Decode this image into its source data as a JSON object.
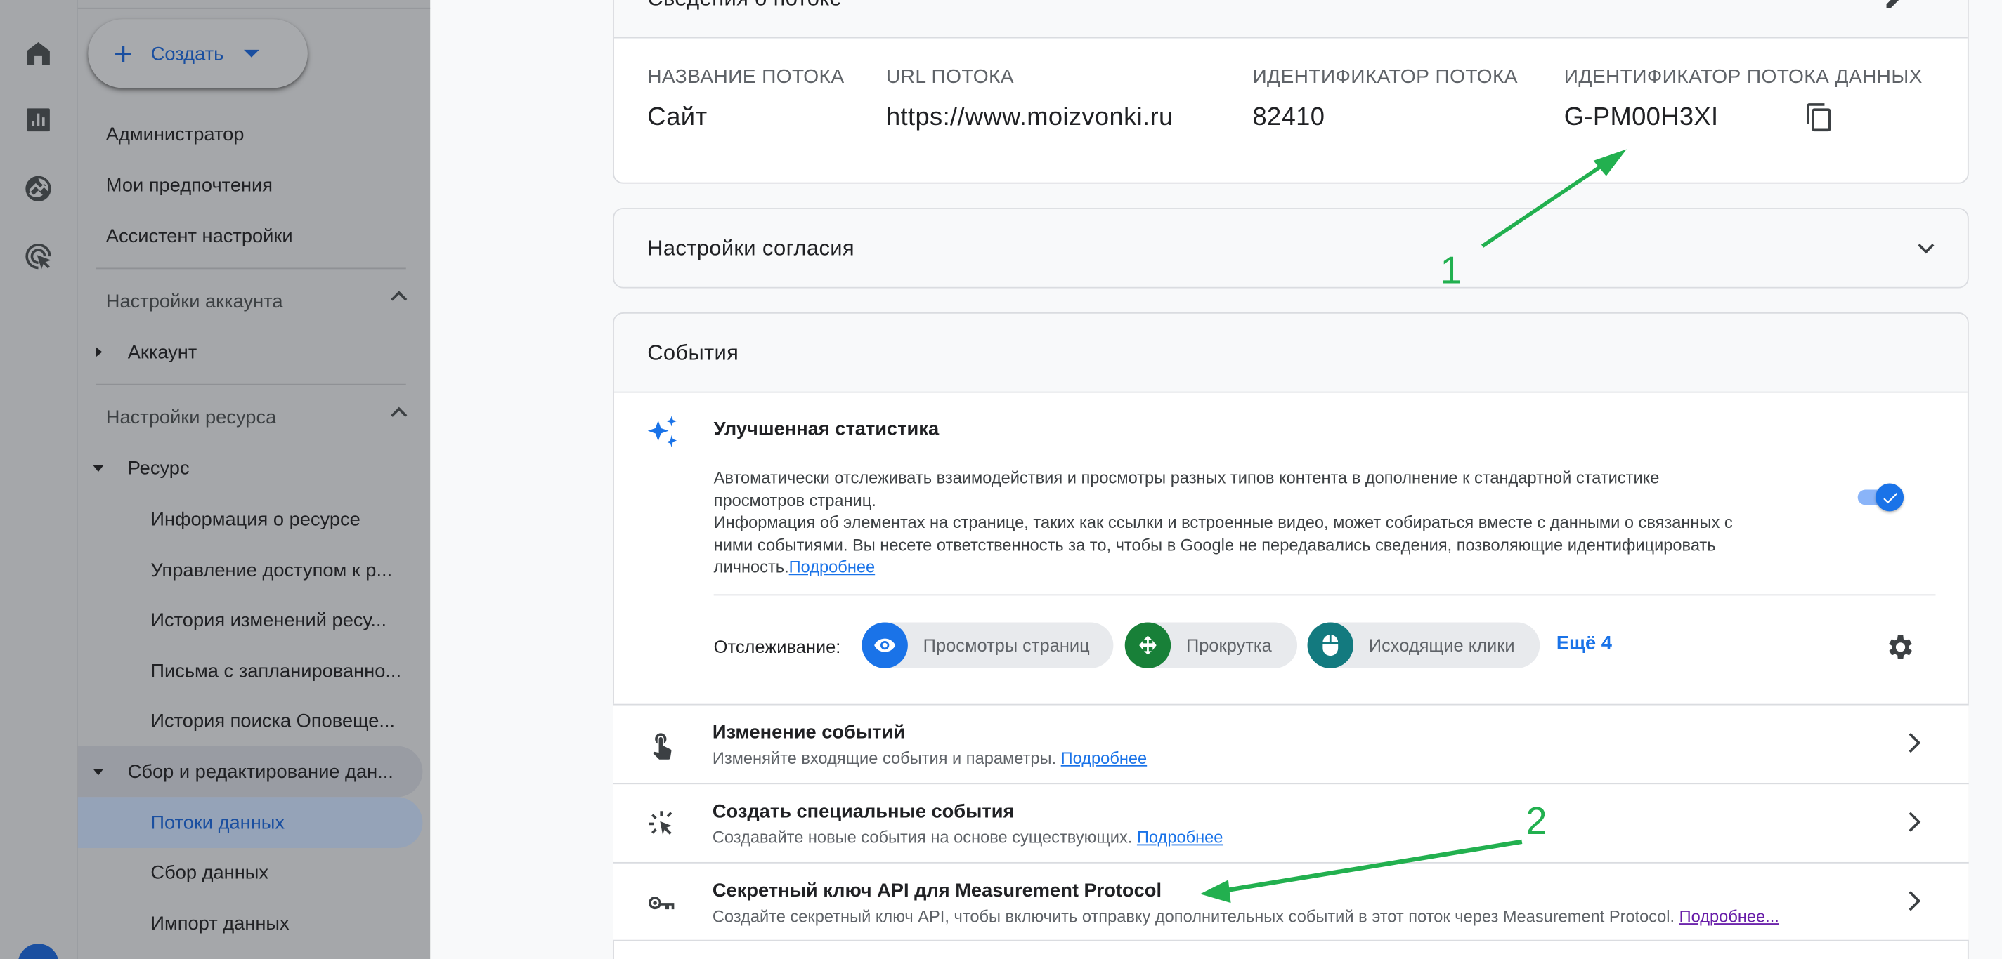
{
  "sidebar": {
    "create_label": "Создать",
    "items": {
      "admin": "Администратор",
      "prefs": "Мои предпочтения",
      "assistant": "Ассистент настройки",
      "account_settings": "Настройки аккаунта",
      "account": "Аккаунт",
      "resource_settings": "Настройки ресурса",
      "resource": "Ресурс",
      "resource_info": "Информация о ресурсе",
      "access_mgmt": "Управление доступом к р...",
      "change_history": "История изменений ресу...",
      "scheduled_emails": "Письма с запланированно...",
      "alerts_history": "История поиска Оповеще...",
      "data_collection": "Сбор и редактирование дан...",
      "data_streams": "Потоки данных",
      "data_gathering": "Сбор данных",
      "data_import": "Импорт данных"
    }
  },
  "stream_details": {
    "header": "Сведения о потоке",
    "name_label": "НАЗВАНИЕ ПОТОКА",
    "name_value": "Сайт",
    "url_label": "URL ПОТОКА",
    "url_value": "https://www.moizvonki.ru",
    "id_label": "ИДЕНТИФИКАТОР ПОТОКА",
    "id_value": "82410",
    "measurement_label": "ИДЕНТИФИКАТОР ПОТОКА ДАННЫХ",
    "measurement_value": "G-PM00H3XI"
  },
  "consent": {
    "title": "Настройки согласия"
  },
  "events": {
    "title": "События",
    "enhanced": {
      "title": "Улучшенная статистика",
      "desc_line1": "Автоматически отслеживать взаимодействия и просмотры разных типов контента в дополнение к стандартной статистике",
      "desc_line2": "просмотров страниц.",
      "desc_line3": "Информация об элементах на странице, таких как ссылки и встроенные видео, может собираться вместе с данными о связанных с",
      "desc_line4": "ними событиями. Вы несете ответственность за то, чтобы в Google не передавались сведения, позволяющие идентифицировать",
      "desc_line5": "личность.",
      "more_link": "Подробнее",
      "toggle_on": true,
      "tracking_label": "Отслеживание:",
      "chips": [
        "Просмотры страниц",
        "Прокрутка",
        "Исходящие клики"
      ],
      "more_chips": "Ещё 4"
    },
    "rows": [
      {
        "title": "Изменение событий",
        "desc": "Изменяйте входящие события и параметры.",
        "link": "Подробнее"
      },
      {
        "title": "Создать специальные события",
        "desc": "Создавайте новые события на основе существующих.",
        "link": "Подробнее"
      },
      {
        "title": "Секретный ключ API для Measurement Protocol",
        "desc": "Создайте секретный ключ API, чтобы включить отправку дополнительных событий в этот поток через Measurement Protocol.",
        "link": "Подробнее..."
      }
    ]
  },
  "annotations": {
    "a1": "1",
    "a2": "2"
  },
  "colors": {
    "accent": "#1a73e8",
    "annotation": "#22b04f",
    "chip_blue": "#1a73e8",
    "chip_green": "#188038",
    "chip_teal": "#137a7f"
  }
}
